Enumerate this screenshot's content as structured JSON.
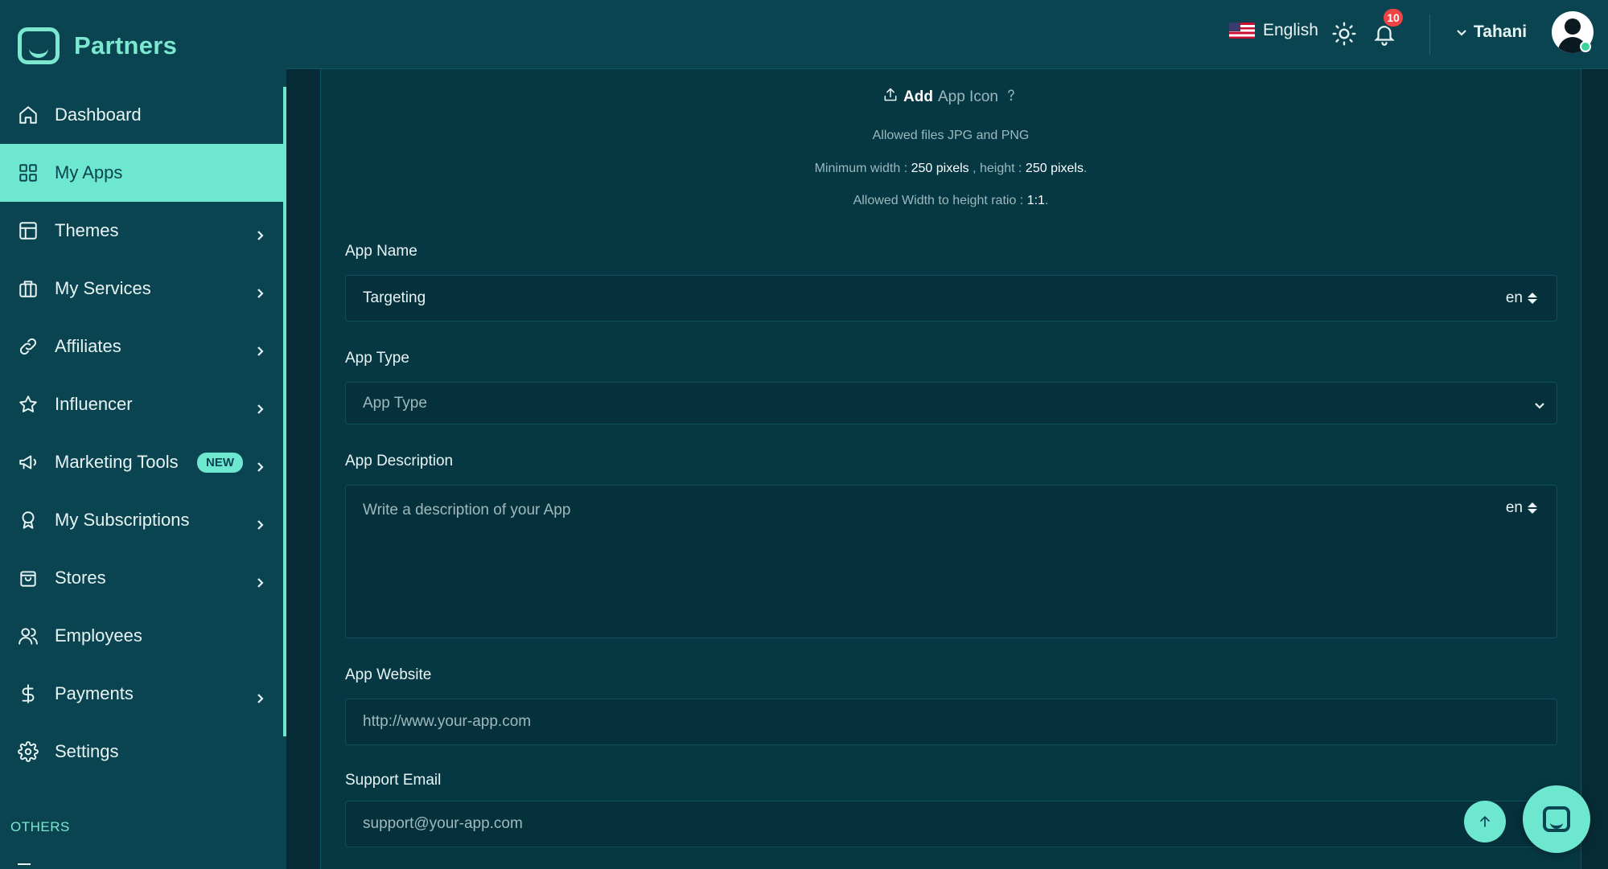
{
  "brand": {
    "name": "Partners"
  },
  "sidebar": {
    "items": [
      {
        "label": "Dashboard",
        "icon": "home-icon",
        "chevron": false,
        "active": false
      },
      {
        "label": "My Apps",
        "icon": "grid-icon",
        "chevron": false,
        "active": true
      },
      {
        "label": "Themes",
        "icon": "layout-icon",
        "chevron": true,
        "active": false
      },
      {
        "label": "My Services",
        "icon": "briefcase-icon",
        "chevron": true,
        "active": false
      },
      {
        "label": "Affiliates",
        "icon": "link-icon",
        "chevron": true,
        "active": false
      },
      {
        "label": "Influencer",
        "icon": "star-icon",
        "chevron": true,
        "active": false
      },
      {
        "label": "Marketing Tools",
        "icon": "megaphone-icon",
        "chevron": true,
        "active": false,
        "badge": "NEW"
      },
      {
        "label": "My Subscriptions",
        "icon": "award-icon",
        "chevron": true,
        "active": false
      },
      {
        "label": "Stores",
        "icon": "bag-icon",
        "chevron": true,
        "active": false
      },
      {
        "label": "Employees",
        "icon": "users-icon",
        "chevron": false,
        "active": false
      },
      {
        "label": "Payments",
        "icon": "dollar-icon",
        "chevron": true,
        "active": false
      },
      {
        "label": "Settings",
        "icon": "gear-icon",
        "chevron": false,
        "active": false
      }
    ],
    "others_label": "OTHERS"
  },
  "header": {
    "language": "English",
    "notification_count": "10",
    "user_name": "Tahani"
  },
  "upload": {
    "action_strong": "Add",
    "action_muted": "App Icon",
    "allowed_files": "Allowed files JPG and PNG",
    "min_label_1": "Minimum width :",
    "min_width": "250 pixels",
    "min_label_2": ", height :",
    "min_height": "250 pixels",
    "min_end": ".",
    "ratio_label": "Allowed Width to height ratio :",
    "ratio_value": "1:1",
    "ratio_end": "."
  },
  "form": {
    "app_name": {
      "label": "App Name",
      "value": "Targeting",
      "lang": "en"
    },
    "app_type": {
      "label": "App Type",
      "placeholder": "App Type"
    },
    "app_description": {
      "label": "App Description",
      "placeholder": "Write a description of your App",
      "lang": "en"
    },
    "app_website": {
      "label": "App Website",
      "placeholder": "http://www.your-app.com"
    },
    "support_email": {
      "label": "Support Email",
      "placeholder": "support@your-app.com"
    }
  },
  "colors": {
    "accent": "#6ee7d0",
    "sidebar_bg": "#0a4451",
    "content_bg": "#063844",
    "notification": "#f04444"
  }
}
